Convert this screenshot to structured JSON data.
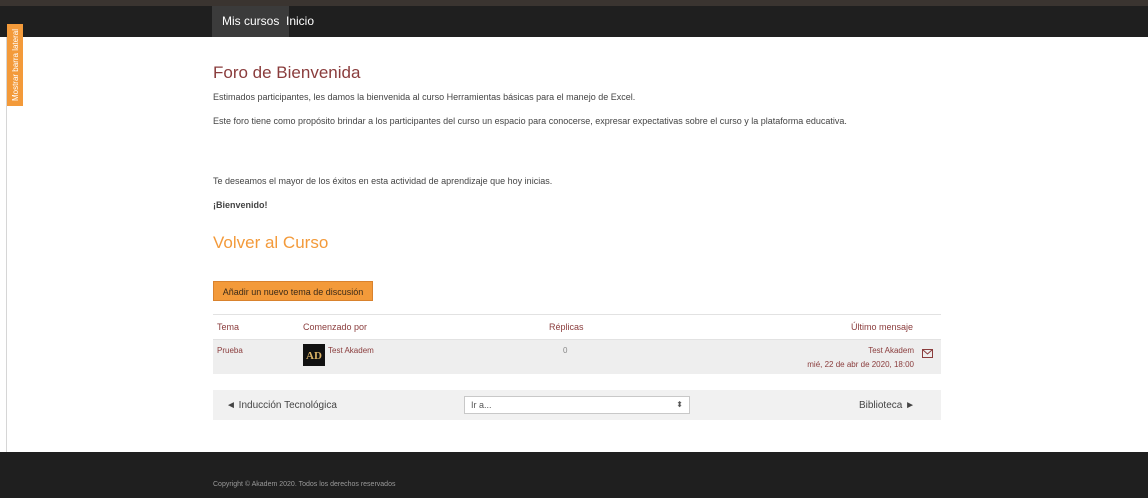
{
  "nav": {
    "items": [
      {
        "label": "Mis cursos",
        "active": true
      },
      {
        "label": "Inicio",
        "active": false
      }
    ]
  },
  "sidebar_tab": {
    "label": "Mostrar barra lateral"
  },
  "forum": {
    "title": "Foro de Bienvenida",
    "paragraphs": [
      "Estimados participantes, les damos la bienvenida al curso Herramientas básicas para el manejo de Excel.",
      "Este foro tiene como propósito brindar a los participantes del curso un espacio para conocerse, expresar expectativas sobre el curso y la plataforma educativa.",
      "Te deseamos el mayor de los éxitos en esta actividad de aprendizaje que hoy inicias."
    ],
    "welcome": "¡Bienvenido!",
    "back_link": "Volver al Curso",
    "add_button": "Añadir un nuevo tema de discusión"
  },
  "table": {
    "headers": {
      "topic": "Tema",
      "started_by": "Comenzado por",
      "replies": "Réplicas",
      "last_post": "Último mensaje"
    },
    "rows": [
      {
        "topic": "Prueba",
        "author": "Test Akadem",
        "avatar_text": "AD",
        "replies": "0",
        "last_author": "Test Akadem",
        "last_date": "mié, 22 de abr de 2020, 18:00"
      }
    ]
  },
  "activity_nav": {
    "prev": "◄ Inducción Tecnológica",
    "jump": "Ir a...",
    "next": "Biblioteca ►"
  },
  "footer": {
    "text": "Copyright © Akadem 2020. Todos los derechos reservados"
  },
  "colors": {
    "accent": "#f39a3a",
    "link": "#8a3c3c",
    "navbar": "#1f1f1f"
  }
}
